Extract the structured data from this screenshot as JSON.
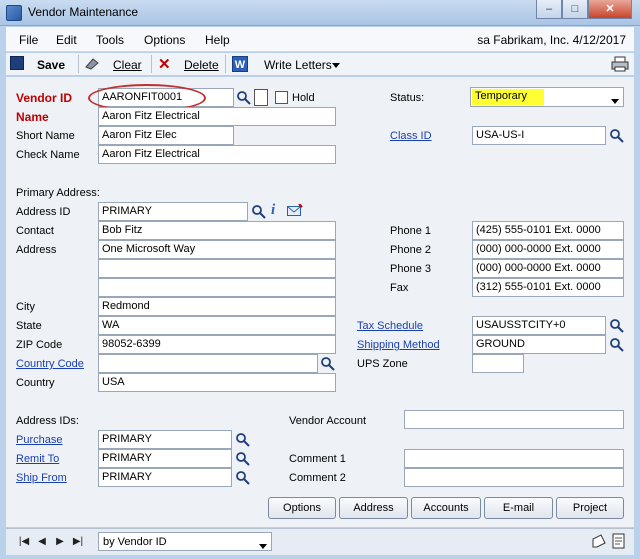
{
  "window": {
    "title": "Vendor Maintenance",
    "minimize": "–",
    "maximize": "□",
    "close": "✕"
  },
  "menu": {
    "items": [
      "File",
      "Edit",
      "Tools",
      "Options",
      "Help"
    ],
    "company_info": "sa  Fabrikam, Inc.  4/12/2017"
  },
  "toolbar": {
    "save": "Save",
    "clear": "Clear",
    "delete": "Delete",
    "write_letters": "Write Letters"
  },
  "vendor": {
    "vendor_id_label": "Vendor ID",
    "vendor_id": "AARONFIT0001",
    "hold_label": "Hold",
    "name_label": "Name",
    "name": "Aaron Fitz Electrical",
    "short_name_label": "Short Name",
    "short_name": "Aaron Fitz Elec",
    "check_name_label": "Check Name",
    "check_name": "Aaron Fitz Electrical"
  },
  "status": {
    "label": "Status:",
    "value": "Temporary",
    "highlight_color": "#ffff33"
  },
  "class": {
    "label": "Class ID",
    "value": "USA-US-I"
  },
  "address": {
    "section_label": "Primary Address:",
    "address_id_label": "Address ID",
    "address_id": "PRIMARY",
    "contact_label": "Contact",
    "contact": "Bob Fitz",
    "address_label": "Address",
    "address_line1": "One Microsoft Way",
    "address_line2": "",
    "address_line3": "",
    "city_label": "City",
    "city": "Redmond",
    "state_label": "State",
    "state": "WA",
    "zip_label": "ZIP Code",
    "zip": "98052-6399",
    "country_code_label": "Country Code",
    "country_code": "",
    "country_label": "Country",
    "country": "USA"
  },
  "phones": {
    "phone1_label": "Phone 1",
    "phone1": "(425) 555-0101  Ext. 0000",
    "phone2_label": "Phone 2",
    "phone2": "(000) 000-0000  Ext. 0000",
    "phone3_label": "Phone 3",
    "phone3": "(000) 000-0000  Ext. 0000",
    "fax_label": "Fax",
    "fax": "(312) 555-0101  Ext. 0000"
  },
  "tax": {
    "tax_schedule_label": "Tax Schedule",
    "tax_schedule": "USAUSSTCITY+0",
    "shipping_method_label": "Shipping Method",
    "shipping_method": "GROUND",
    "ups_zone_label": "UPS Zone",
    "ups_zone": ""
  },
  "address_ids": {
    "section_label": "Address IDs:",
    "purchase_label": "Purchase",
    "purchase": "PRIMARY",
    "remit_to_label": "Remit To",
    "remit_to": "PRIMARY",
    "ship_from_label": "Ship From",
    "ship_from": "PRIMARY"
  },
  "account": {
    "vendor_account_label": "Vendor Account",
    "vendor_account": "",
    "comment1_label": "Comment 1",
    "comment1": "",
    "comment2_label": "Comment 2",
    "comment2": ""
  },
  "buttons": {
    "options": "Options",
    "address": "Address",
    "accounts": "Accounts",
    "email": "E-mail",
    "project": "Project"
  },
  "footer": {
    "sort_by": "by Vendor ID"
  }
}
